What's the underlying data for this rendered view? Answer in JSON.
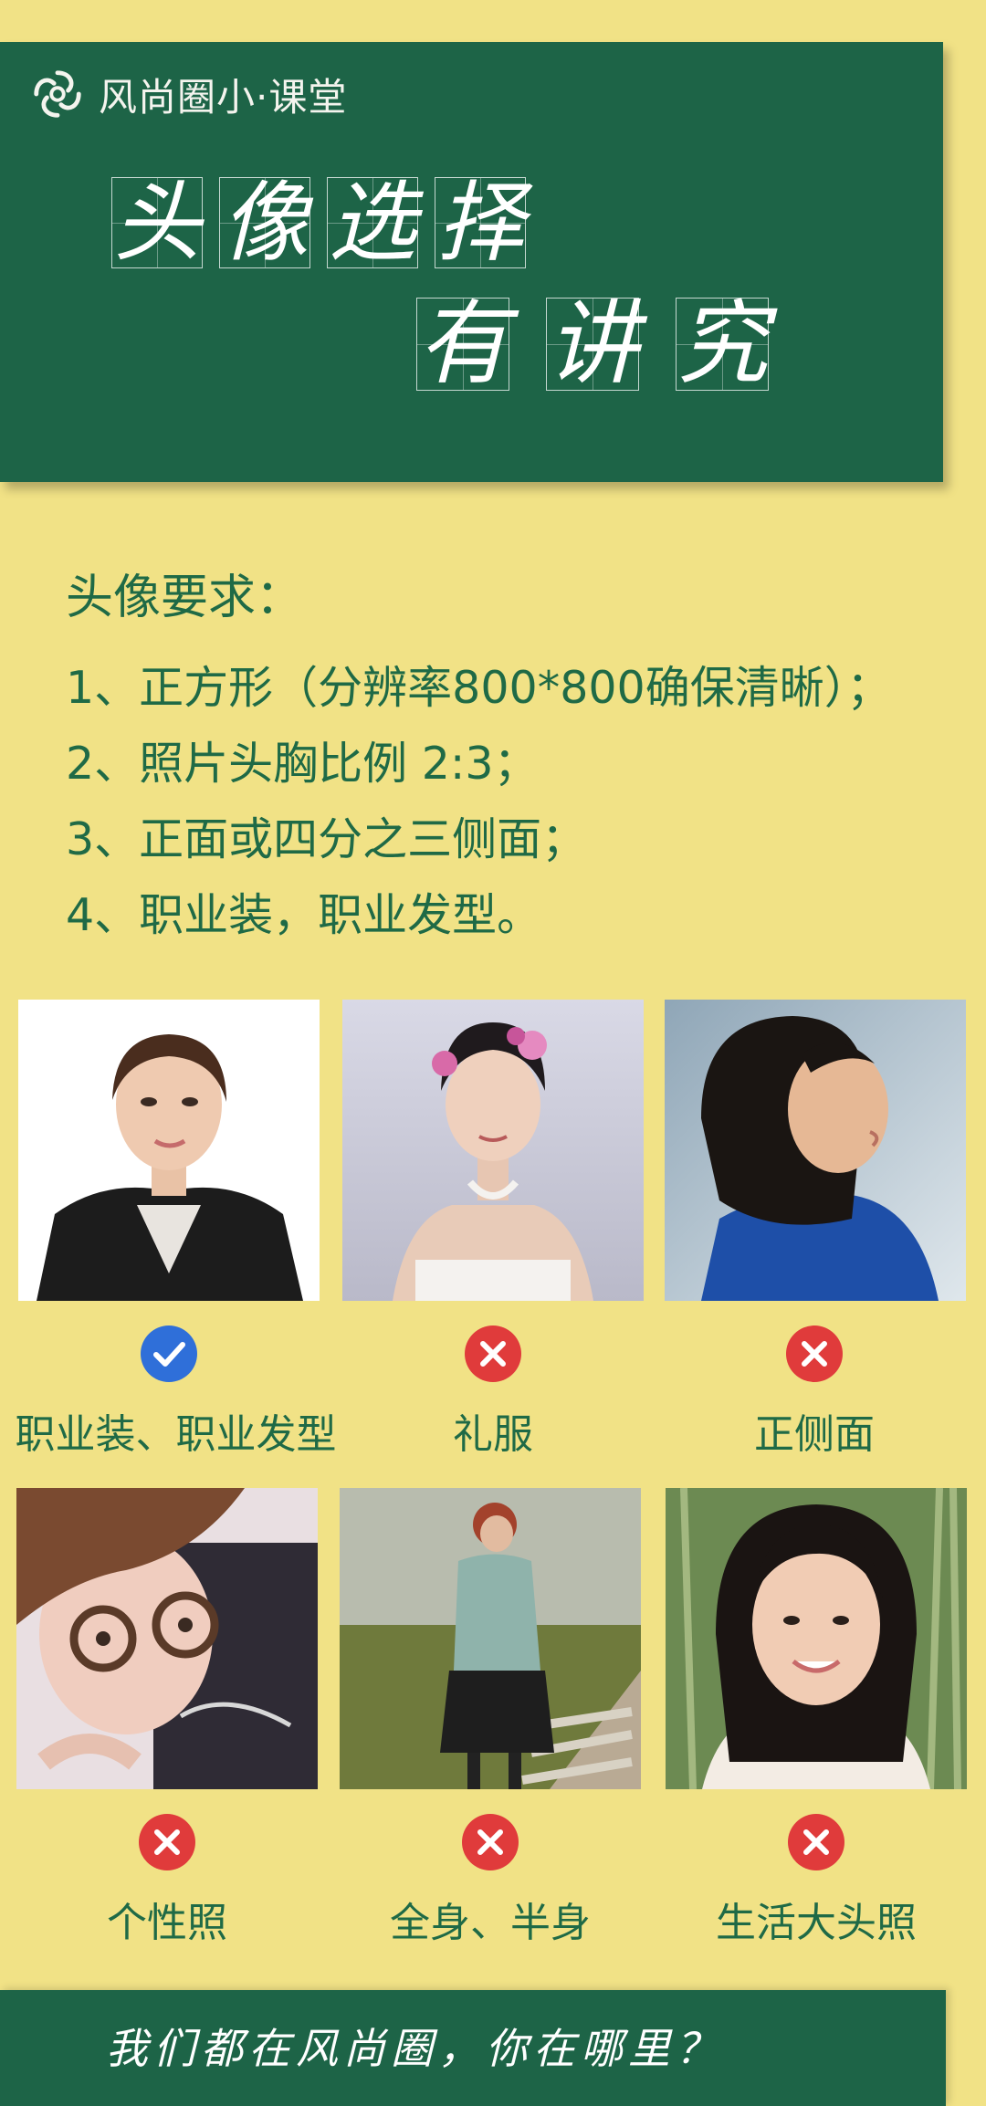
{
  "header": {
    "brand": "风尚圈小·课堂",
    "title_line1": [
      "头",
      "像",
      "选",
      "择"
    ],
    "title_line2": [
      "有",
      "讲",
      "究"
    ]
  },
  "requirements": {
    "title": "头像要求：",
    "items": [
      "1、正方形（分辨率800*800确保清晰）；",
      "2、照片头胸比例 2:3；",
      "3、正面或四分之三侧面；",
      "4、职业装，职业发型。"
    ]
  },
  "examples": [
    {
      "caption": "职业装、职业发型",
      "status": "correct",
      "icon": "check-icon",
      "photo": "professional-portrait"
    },
    {
      "caption": "礼服",
      "status": "wrong",
      "icon": "cross-icon",
      "photo": "evening-gown-portrait"
    },
    {
      "caption": "正侧面",
      "status": "wrong",
      "icon": "cross-icon",
      "photo": "side-profile-portrait"
    },
    {
      "caption": "个性照",
      "status": "wrong",
      "icon": "cross-icon",
      "photo": "selfie-portrait"
    },
    {
      "caption": "全身、半身",
      "status": "wrong",
      "icon": "cross-icon",
      "photo": "full-body-photo"
    },
    {
      "caption": "生活大头照",
      "status": "wrong",
      "icon": "cross-icon",
      "photo": "casual-headshot"
    }
  ],
  "footer": {
    "text": "我们都在风尚圈，你在哪里？"
  },
  "colors": {
    "background": "#f1e286",
    "panel": "#1d6447",
    "text": "#1f6a46",
    "correct": "#2f6fd9",
    "wrong": "#e03b3b"
  }
}
